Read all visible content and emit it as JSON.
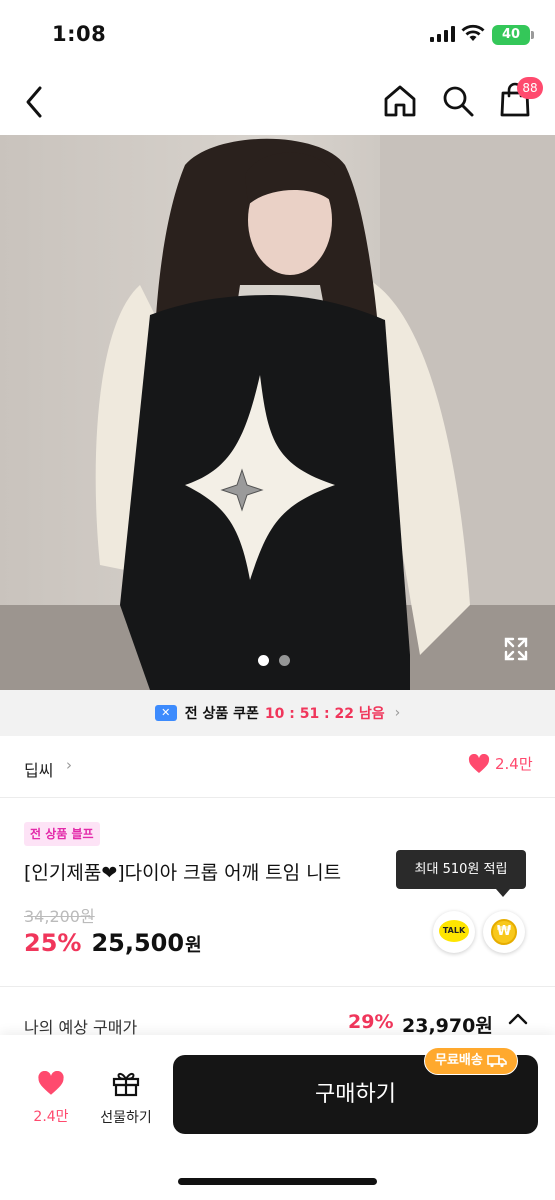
{
  "status_bar": {
    "time": "1:08",
    "battery": "40"
  },
  "nav": {
    "cart_count": "88"
  },
  "hero": {
    "page_indicator_active": 1,
    "page_indicator_total": 2
  },
  "coupon": {
    "label": "전 상품 쿠폰",
    "timer": "10 : 51 : 22 남음",
    "chevron": "›"
  },
  "brand": {
    "name": "딥씨",
    "chevron": "›",
    "like_count": "2.4만"
  },
  "product": {
    "tag": "전 상품 블프",
    "title": "[인기제품❤]다이아 크롭  어깨 트임 니트",
    "original_price": "34,200원",
    "discount": "25%",
    "price": "25,500",
    "won": "원"
  },
  "tooltip": {
    "text": "최대 510원 적립"
  },
  "share": {
    "talk_label": "TALK",
    "won_label": "₩"
  },
  "expected": {
    "label": "나의 예상 구매가",
    "discount": "29%",
    "price": "23,970원"
  },
  "bottom": {
    "like_count": "2.4만",
    "gift_label": "선물하기",
    "buy_label": "구매하기",
    "free_shipping": "무료배송"
  },
  "colors": {
    "accent": "#f0365b",
    "heart": "#ff4a6e",
    "shipping_badge": "#ffa92e",
    "buy_button": "#151515"
  }
}
